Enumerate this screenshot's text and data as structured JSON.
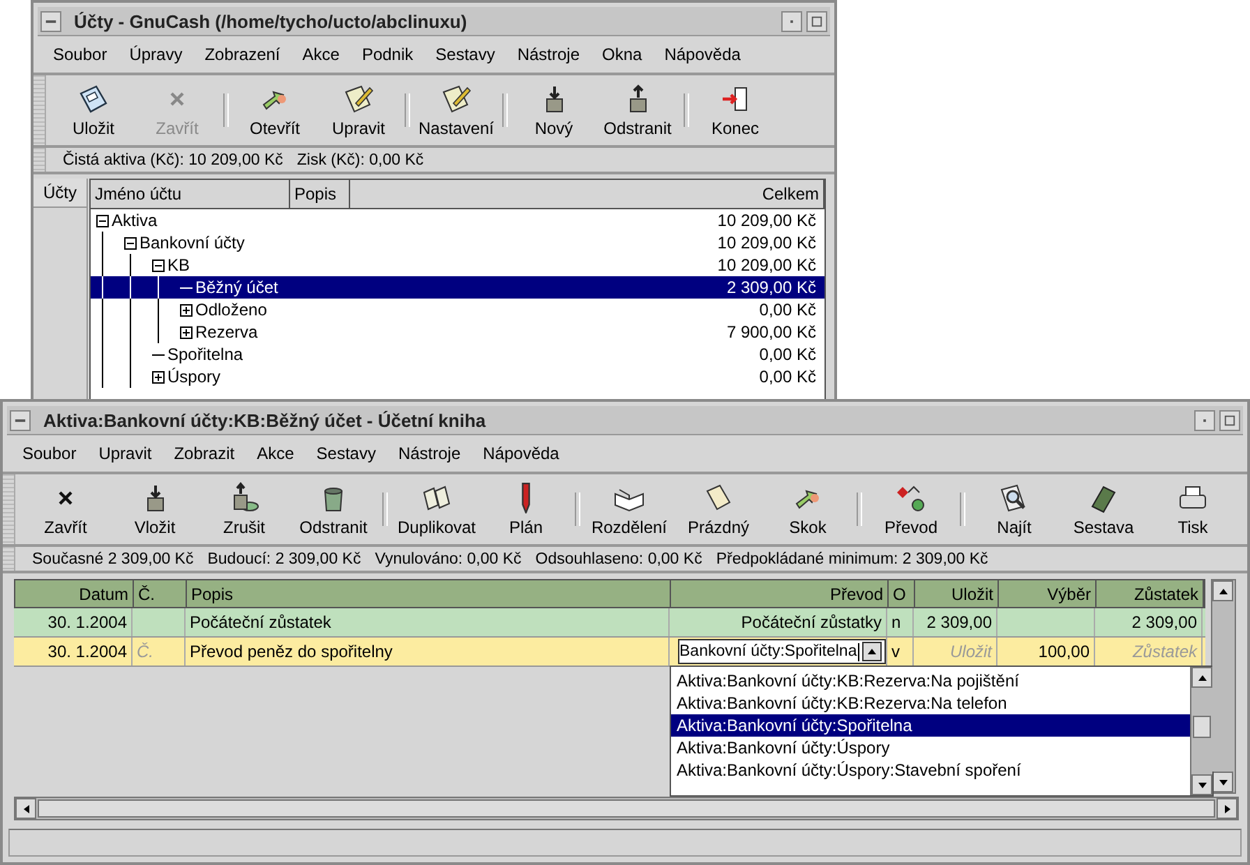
{
  "accounts_window": {
    "title": "Účty - GnuCash (/home/tycho/ucto/abclinuxu)",
    "menu": [
      "Soubor",
      "Úpravy",
      "Zobrazení",
      "Akce",
      "Podnik",
      "Sestavy",
      "Nástroje",
      "Okna",
      "Nápověda"
    ],
    "toolbar_groups": [
      [
        {
          "label": "Uložit",
          "kind": "save",
          "disabled": false
        },
        {
          "label": "Zavřít",
          "kind": "close",
          "disabled": true
        }
      ],
      [
        {
          "label": "Otevřít",
          "kind": "open",
          "disabled": false
        },
        {
          "label": "Upravit",
          "kind": "edit",
          "disabled": false
        }
      ],
      [
        {
          "label": "Nastavení",
          "kind": "edit",
          "disabled": false
        }
      ],
      [
        {
          "label": "Nový",
          "kind": "new",
          "disabled": false
        },
        {
          "label": "Odstranit",
          "kind": "remove",
          "disabled": false
        }
      ],
      [
        {
          "label": "Konec",
          "kind": "exit",
          "disabled": false
        }
      ]
    ],
    "summary": [
      "Čistá aktiva (Kč): 10 209,00 Kč",
      "Zisk (Kč): 0,00 Kč"
    ],
    "side_tab": "Účty",
    "columns": [
      "Jméno účtu",
      "Popis",
      "Celkem"
    ],
    "tree": [
      {
        "name": "Aktiva",
        "total": "10 209,00 Kč",
        "expanded": true,
        "selected": false,
        "children": [
          {
            "name": "Bankovní účty",
            "total": "10 209,00 Kč",
            "expanded": true,
            "selected": false,
            "children": [
              {
                "name": "KB",
                "total": "10 209,00 Kč",
                "expanded": true,
                "selected": false,
                "children": [
                  {
                    "name": "Běžný účet",
                    "total": "2 309,00 Kč",
                    "selected": true
                  },
                  {
                    "name": "Odloženo",
                    "total": "0,00 Kč",
                    "expanded": false,
                    "selected": false
                  },
                  {
                    "name": "Rezerva",
                    "total": "7 900,00 Kč",
                    "expanded": false,
                    "selected": false
                  }
                ]
              },
              {
                "name": "Spořitelna",
                "total": "0,00 Kč",
                "selected": false
              },
              {
                "name": "Úspory",
                "total": "0,00 Kč",
                "expanded": false,
                "selected": false
              }
            ]
          }
        ]
      }
    ]
  },
  "register_window": {
    "title": "Aktiva:Bankovní účty:KB:Běžný účet - Účetní kniha",
    "menu": [
      "Soubor",
      "Upravit",
      "Zobrazit",
      "Akce",
      "Sestavy",
      "Nástroje",
      "Nápověda"
    ],
    "toolbar_groups": [
      [
        {
          "label": "Zavřít",
          "kind": "close"
        },
        {
          "label": "Vložit",
          "kind": "new"
        },
        {
          "label": "Zrušit",
          "kind": "cancel"
        },
        {
          "label": "Odstranit",
          "kind": "trash"
        }
      ],
      [
        {
          "label": "Duplikovat",
          "kind": "duplicate"
        },
        {
          "label": "Plán",
          "kind": "pen"
        }
      ],
      [
        {
          "label": "Rozdělení",
          "kind": "book"
        },
        {
          "label": "Prázdný",
          "kind": "page"
        },
        {
          "label": "Skok",
          "kind": "open"
        }
      ],
      [
        {
          "label": "Převod",
          "kind": "transfer"
        }
      ],
      [
        {
          "label": "Najít",
          "kind": "find"
        },
        {
          "label": "Sestava",
          "kind": "report"
        },
        {
          "label": "Tisk",
          "kind": "print"
        }
      ]
    ],
    "summary": [
      "Současné 2 309,00 Kč",
      "Budoucí: 2 309,00 Kč",
      "Vynulováno: 0,00 Kč",
      "Odsouhlaseno: 0,00 Kč",
      "Předpokládané minimum: 2 309,00 Kč"
    ],
    "columns": [
      "Datum",
      "Č.",
      "Popis",
      "Převod",
      "O",
      "Uložit",
      "Výběr",
      "Zůstatek"
    ],
    "rows": [
      {
        "selected": false,
        "cells": [
          {
            "text": "30. 1.2004"
          },
          {},
          {
            "text": "Počáteční zůstatek"
          },
          {
            "text": "Počáteční zůstatky"
          },
          {
            "text": "n"
          },
          {
            "text": "2 309,00"
          },
          {},
          {
            "text": "2 309,00"
          }
        ]
      },
      {
        "selected": true,
        "cells": [
          {
            "text": "30. 1.2004"
          },
          {
            "placeholder": "Č."
          },
          {
            "text": "Převod peněz do spořitelny"
          },
          {
            "text": "Bankovní účty:Spořitelna",
            "kind": "combo"
          },
          {
            "text": "v"
          },
          {
            "placeholder": "Uložit"
          },
          {
            "text": "100,00"
          },
          {
            "placeholder": "Zůstatek"
          }
        ]
      }
    ],
    "account_list": [
      {
        "label": "Aktiva:Bankovní účty:KB:Rezerva:Na pojištění",
        "selected": false
      },
      {
        "label": "Aktiva:Bankovní účty:KB:Rezerva:Na telefon",
        "selected": false
      },
      {
        "label": "Aktiva:Bankovní účty:Spořitelna",
        "selected": true
      },
      {
        "label": "Aktiva:Bankovní účty:Úspory",
        "selected": false
      },
      {
        "label": "Aktiva:Bankovní účty:Úspory:Stavební spoření",
        "selected": false
      }
    ]
  }
}
